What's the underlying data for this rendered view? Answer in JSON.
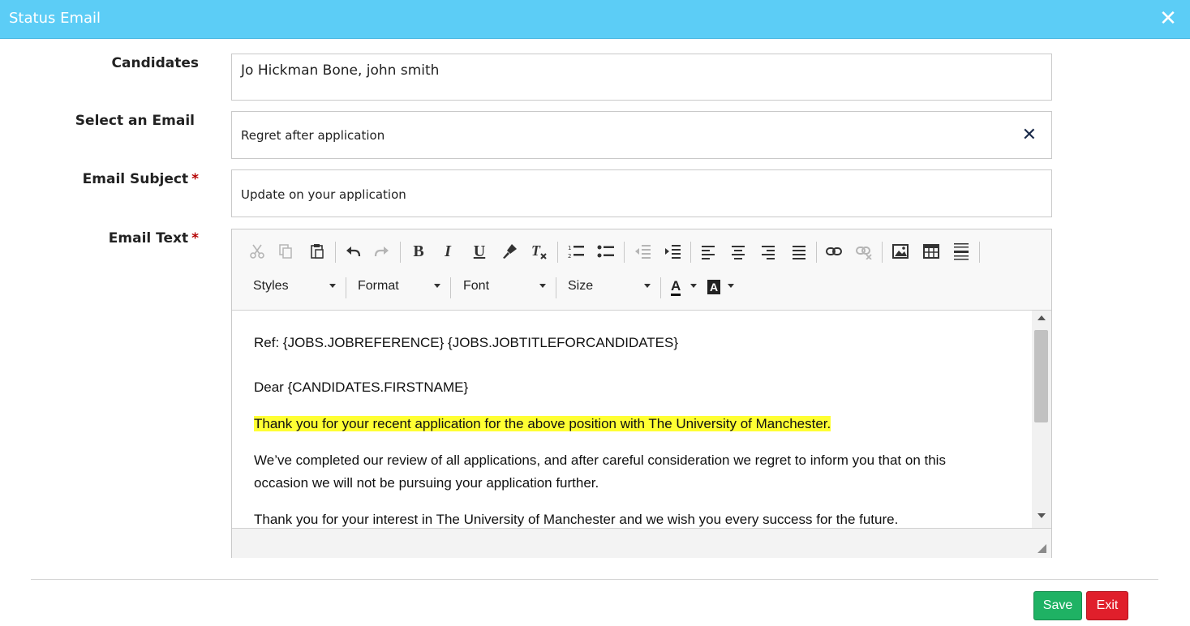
{
  "header": {
    "title": "Status Email"
  },
  "form": {
    "candidates": {
      "label": "Candidates",
      "value": "Jo Hickman Bone, john smith"
    },
    "select_email": {
      "label": "Select an Email",
      "value": "Regret after application",
      "clear_glyph": "✕"
    },
    "subject": {
      "label": "Email Subject",
      "required_mark": "*",
      "value": "Update on your application"
    },
    "email_text": {
      "label": "Email Text",
      "required_mark": "*"
    }
  },
  "toolbar": {
    "row1_icons": [
      "cut-icon",
      "copy-icon",
      "paste-icon",
      "undo-icon",
      "redo-icon",
      "bold-icon",
      "italic-icon",
      "underline-icon",
      "copy-format-icon",
      "remove-format-icon",
      "numbered-list-icon",
      "bulleted-list-icon",
      "decrease-indent-icon",
      "increase-indent-icon",
      "align-left-icon",
      "align-center-icon",
      "align-right-icon",
      "justify-icon",
      "link-icon",
      "unlink-icon",
      "image-icon",
      "table-icon",
      "horizontal-line-icon"
    ],
    "glyphs": {
      "bold": "B",
      "italic": "I",
      "underline": "U",
      "text_color": "A",
      "bg_color": "A"
    },
    "combos": {
      "styles": "Styles",
      "format": "Format",
      "font": "Font",
      "size": "Size"
    }
  },
  "editor": {
    "line1": "Ref: {JOBS.JOBREFERENCE} {JOBS.JOBTITLEFORCANDIDATES}",
    "line2": "Dear {CANDIDATES.FIRSTNAME}",
    "line3": "Thank you for your recent application for the above position with The University of Manchester.",
    "line4a": "We’ve completed our review of all applications, and after careful consideration we regret to inform you that on this",
    "line4b": "occasion we will not be pursuing your application further.",
    "line5": "Thank you for your interest in The University of Manchester and we wish you every success for the future."
  },
  "actions": {
    "save": "Save",
    "exit": "Exit"
  },
  "colors": {
    "header": "#5ccdf6",
    "save": "#1fb264",
    "exit": "#e01f2b",
    "highlight": "#ffff33",
    "required": "#b40000"
  }
}
